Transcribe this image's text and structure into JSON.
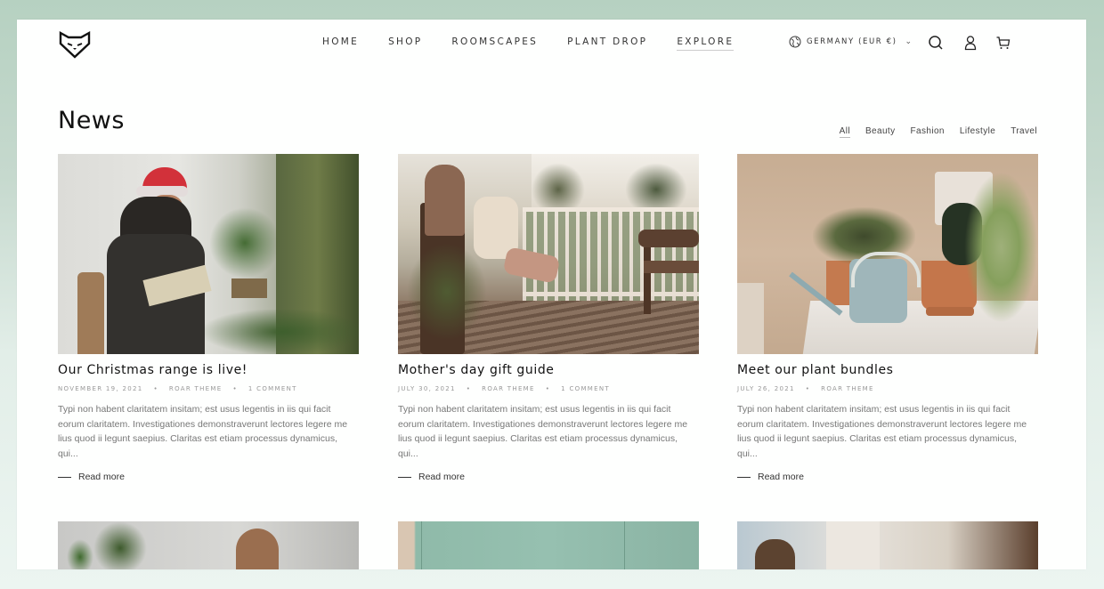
{
  "header": {
    "logo": "fox-logo",
    "nav": [
      {
        "label": "HOME",
        "active": false
      },
      {
        "label": "SHOP",
        "active": false
      },
      {
        "label": "ROOMSCAPES",
        "active": false
      },
      {
        "label": "PLANT DROP",
        "active": false
      },
      {
        "label": "EXPLORE",
        "active": true
      }
    ],
    "country_selector": "GERMANY (EUR €)",
    "icons": [
      "globe-icon",
      "search-icon",
      "account-icon",
      "cart-icon"
    ]
  },
  "page": {
    "title": "News",
    "filters": [
      {
        "label": "All",
        "active": true
      },
      {
        "label": "Beauty",
        "active": false
      },
      {
        "label": "Fashion",
        "active": false
      },
      {
        "label": "Lifestyle",
        "active": false
      },
      {
        "label": "Travel",
        "active": false
      }
    ]
  },
  "articles": [
    {
      "title": "Our Christmas range is live!",
      "date": "NOVEMBER 19, 2021",
      "author": "ROAR THEME",
      "comments": "1 COMMENT",
      "excerpt": "Typi non habent claritatem insitam; est usus legentis in iis qui facit eorum claritatem. Investigationes demonstraverunt lectores legere me lius quod ii legunt saepius. Claritas est etiam processus dynamicus, qui...",
      "read_more": "Read more",
      "image": "woman in santa hat reading a book among plants"
    },
    {
      "title": "Mother's day gift guide",
      "date": "JULY 30, 2021",
      "author": "ROAR THEME",
      "comments": "1 COMMENT",
      "excerpt": "Typi non habent claritatem insitam; est usus legentis in iis qui facit eorum claritatem. Investigationes demonstraverunt lectores legere me lius quod ii legunt saepius. Claritas est etiam processus dynamicus, qui...",
      "read_more": "Read more",
      "image": "mother and child on a porch chair"
    },
    {
      "title": "Meet our plant bundles",
      "date": "JULY 26, 2021",
      "author": "ROAR THEME",
      "comments": "",
      "excerpt": "Typi non habent claritatem insitam; est usus legentis in iis qui facit eorum claritatem. Investigationes demonstraverunt lectores legere me lius quod ii legunt saepius. Claritas est etiam processus dynamicus, qui...",
      "read_more": "Read more",
      "image": "watering can and potted plants on a table"
    }
  ],
  "more_articles_images": [
    "woman near plants against brick wall",
    "teal wall",
    "person working at a table"
  ]
}
